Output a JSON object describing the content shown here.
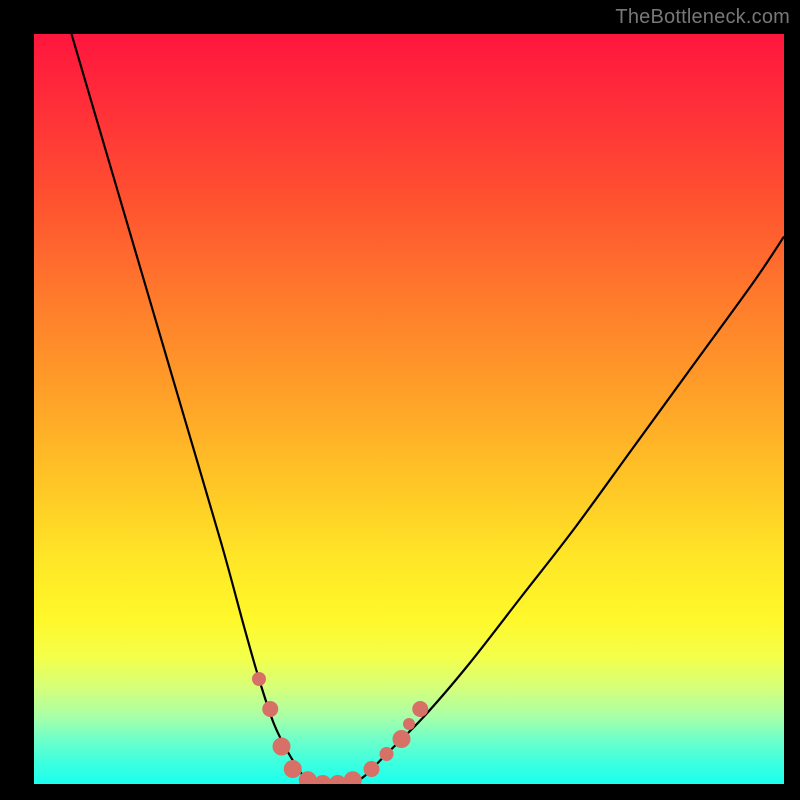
{
  "watermark": "TheBottleneck.com",
  "chart_data": {
    "type": "line",
    "title": "",
    "xlabel": "",
    "ylabel": "",
    "xlim": [
      0,
      100
    ],
    "ylim": [
      0,
      100
    ],
    "grid": false,
    "legend": false,
    "background_gradient": [
      "#ff163e",
      "#ff7a2c",
      "#ffe627",
      "#1affee"
    ],
    "series": [
      {
        "name": "bottleneck-curve",
        "color": "#000000",
        "x": [
          5,
          10,
          15,
          20,
          25,
          28,
          30,
          32,
          34,
          36,
          38,
          40,
          42,
          44,
          47,
          52,
          58,
          65,
          72,
          80,
          88,
          96,
          100
        ],
        "values": [
          100,
          83,
          66,
          49,
          32,
          21,
          14,
          8,
          4,
          1,
          0,
          0,
          0,
          1,
          4,
          9,
          16,
          25,
          34,
          45,
          56,
          67,
          73
        ]
      }
    ],
    "markers": {
      "color": "#d77066",
      "points": [
        {
          "x": 30.0,
          "y": 14,
          "r": 7
        },
        {
          "x": 31.5,
          "y": 10,
          "r": 8
        },
        {
          "x": 33.0,
          "y": 5,
          "r": 9
        },
        {
          "x": 34.5,
          "y": 2,
          "r": 9
        },
        {
          "x": 36.5,
          "y": 0.5,
          "r": 9
        },
        {
          "x": 38.5,
          "y": 0,
          "r": 9
        },
        {
          "x": 40.5,
          "y": 0,
          "r": 9
        },
        {
          "x": 42.5,
          "y": 0.5,
          "r": 9
        },
        {
          "x": 45.0,
          "y": 2,
          "r": 8
        },
        {
          "x": 47.0,
          "y": 4,
          "r": 7
        },
        {
          "x": 49.0,
          "y": 6,
          "r": 9
        },
        {
          "x": 50.0,
          "y": 8,
          "r": 6
        },
        {
          "x": 51.5,
          "y": 10,
          "r": 8
        }
      ]
    }
  }
}
